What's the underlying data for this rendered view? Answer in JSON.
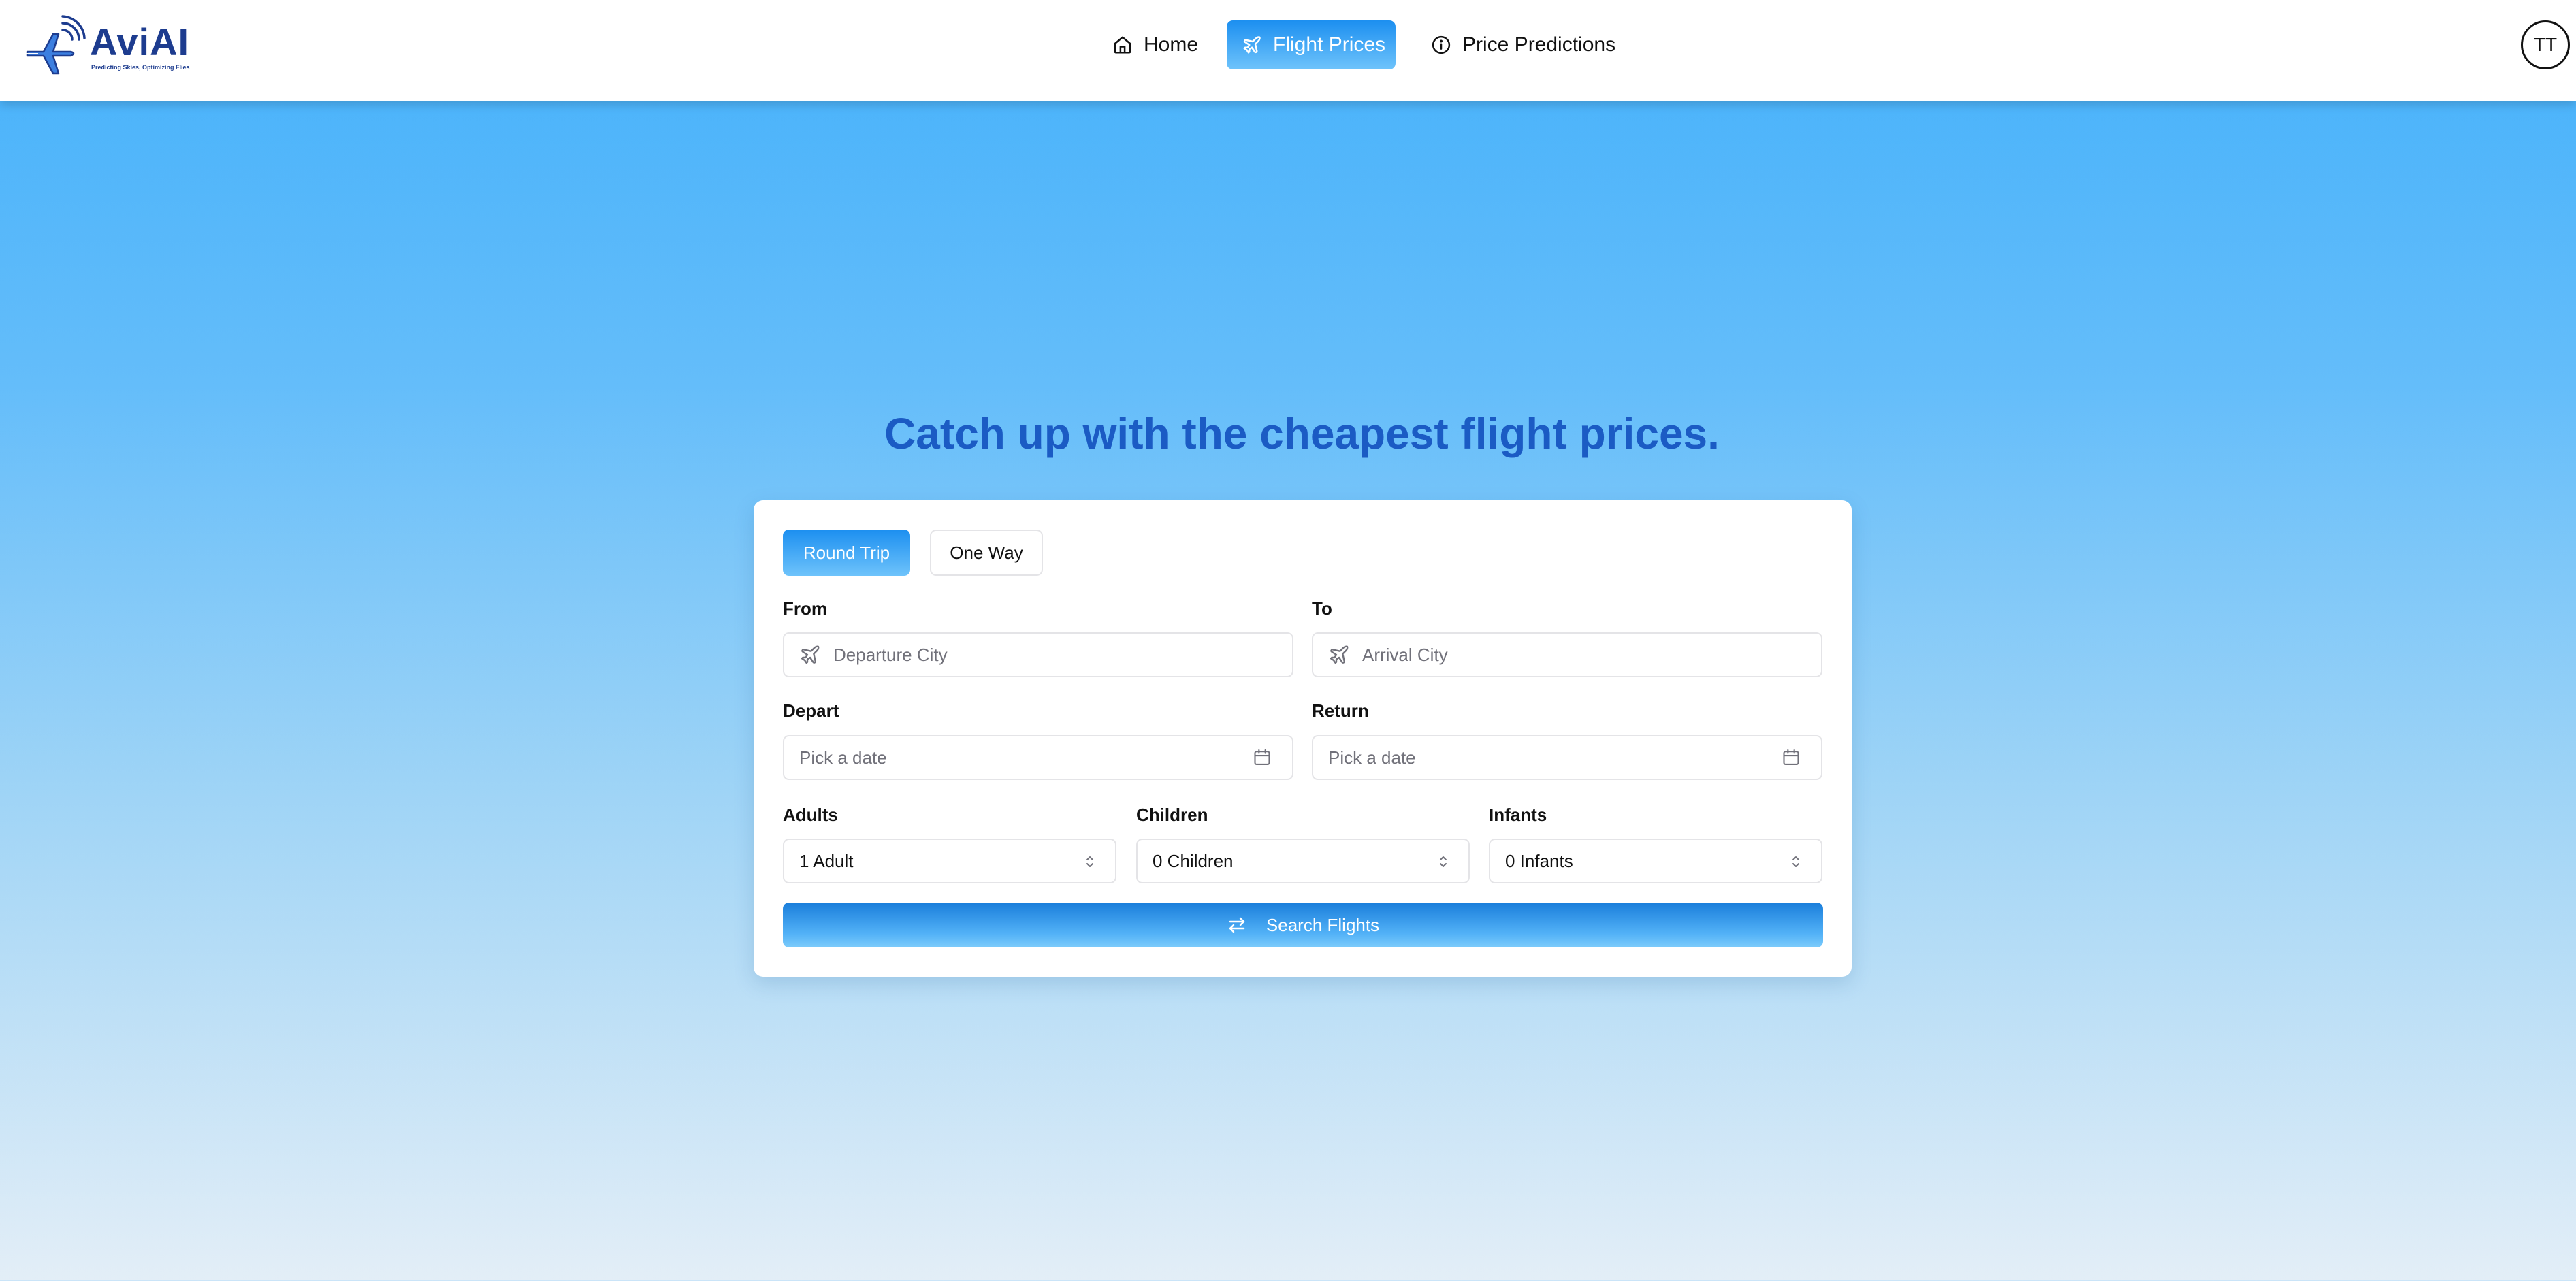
{
  "brand": {
    "name": "AviAI",
    "tagline": "Predicting Skies, Optimizing Flies",
    "color": "#1d3c8f"
  },
  "nav": {
    "items": [
      {
        "label": "Home",
        "icon": "home-icon",
        "active": false
      },
      {
        "label": "Flight Prices",
        "icon": "plane-icon",
        "active": true
      },
      {
        "label": "Price Predictions",
        "icon": "info-icon",
        "active": false
      }
    ]
  },
  "user": {
    "initials": "TT"
  },
  "hero": {
    "title": "Catch up with the cheapest flight prices."
  },
  "search": {
    "trip_types": [
      {
        "label": "Round Trip",
        "selected": true
      },
      {
        "label": "One Way",
        "selected": false
      }
    ],
    "from": {
      "label": "From",
      "placeholder": "Departure City",
      "icon": "plane-icon"
    },
    "to": {
      "label": "To",
      "placeholder": "Arrival City",
      "icon": "plane-icon"
    },
    "depart": {
      "label": "Depart",
      "placeholder": "Pick a date",
      "icon": "calendar-icon"
    },
    "return": {
      "label": "Return",
      "placeholder": "Pick a date",
      "icon": "calendar-icon"
    },
    "adults": {
      "label": "Adults",
      "value": "1 Adult"
    },
    "children": {
      "label": "Children",
      "value": "0 Children"
    },
    "infants": {
      "label": "Infants",
      "value": "0 Infants"
    },
    "submit": {
      "label": "Search Flights",
      "icon": "swap-arrows-icon"
    }
  },
  "colors": {
    "accent": "#1c8ff0",
    "accent_light": "#6ec3fb",
    "hero_title": "#1b5bc4",
    "background_top": "#45b1fb",
    "background_bottom": "#e3eef7"
  }
}
